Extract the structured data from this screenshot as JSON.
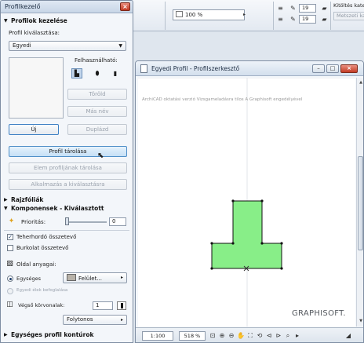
{
  "toolbar": {
    "zoom_value": "100 %",
    "pen1_value": "19",
    "pen2_value": "19",
    "fill_label": "Kitöltés kate",
    "fill_disabled_value": "Metszeti kat"
  },
  "panel": {
    "title": "Profilkezelő",
    "section_profiles": "Profilok kezelése",
    "select_label": "Profil kiválasztása:",
    "select_value": "Egyedi",
    "usable_label": "Felhasználható:",
    "delete_button": "Töröld",
    "rename_button": "Más név",
    "new_button": "Új",
    "duplicate_button": "Duplázd",
    "store_button": "Profil tárolása",
    "store_element_button": "Elem profiljának tárolása",
    "apply_button": "Alkalmazás a kiválasztásra",
    "section_drawing": "Rajzfóliák",
    "section_components": "Komponensek - Kiválasztott",
    "priority_label": "Prioritás:",
    "priority_value": "0",
    "load_bearing_label": "Teherhordó összetevő",
    "load_bearing_checked": true,
    "cladding_label": "Burkolat összetevő",
    "cladding_checked": false,
    "side_material_label": "Oldal anyagai:",
    "uniform_label": "Egységes",
    "surface_value": "Felület...",
    "custom_edges_label": "Egyedi élek befoglalása",
    "end_contours_label": "Végső körvonalak:",
    "end_contours_value": "1",
    "line_type_value": "Folytonos",
    "section_uniform": "Egységes profil kontúrok",
    "colors": {
      "surface_swatch": "#b8b2a8",
      "pen_swatch": "#111111"
    }
  },
  "editor": {
    "title": "Egyedi Profil - Profilszerkesztő",
    "watermark": "ArchiCAD oktatási verzió  Vizsgameladásra tilos  A Graphisoft engedélyével",
    "brand": "GRAPHISOFT.",
    "scale_value": "1:100",
    "zoom_value": "518 %",
    "shape_color": "#88ee88"
  }
}
